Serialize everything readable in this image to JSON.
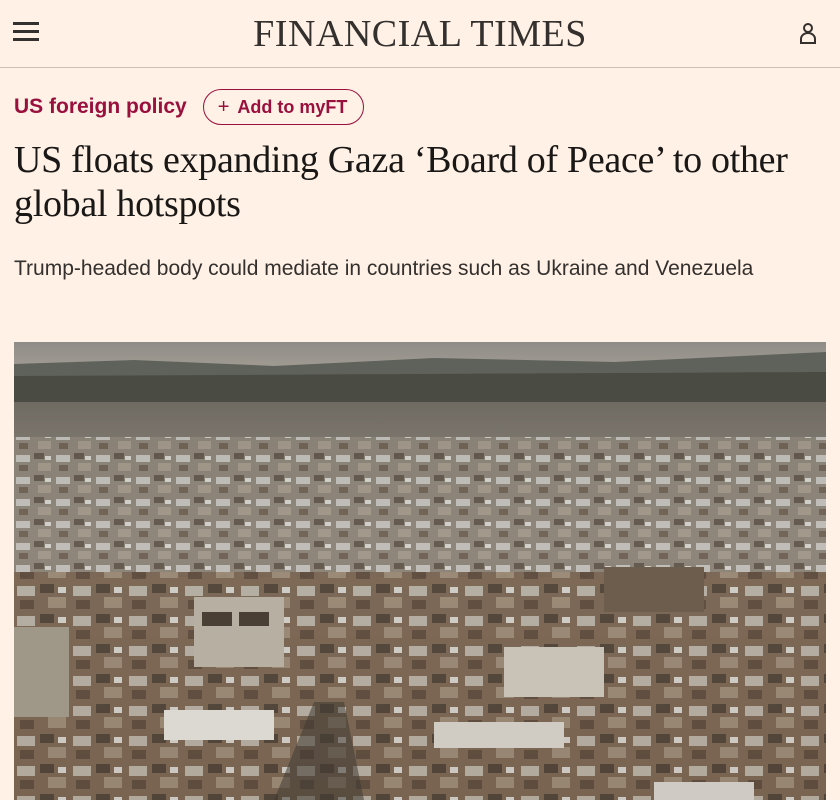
{
  "header": {
    "brand": "FINANCIAL TIMES",
    "menu_icon": "hamburger-menu-icon",
    "user_icon": "user-account-icon"
  },
  "article": {
    "topic": "US foreign policy",
    "follow_label": "Add to myFT",
    "follow_icon": "plus-icon",
    "headline": "US floats expanding Gaza ‘Board of Peace’ to other global hotspots",
    "standfirst": "Trump-headed body could mediate in countries such as Ukraine and Venezuela"
  },
  "colors": {
    "background": "#fff1e5",
    "claret": "#990f3d",
    "text": "#33302e"
  }
}
